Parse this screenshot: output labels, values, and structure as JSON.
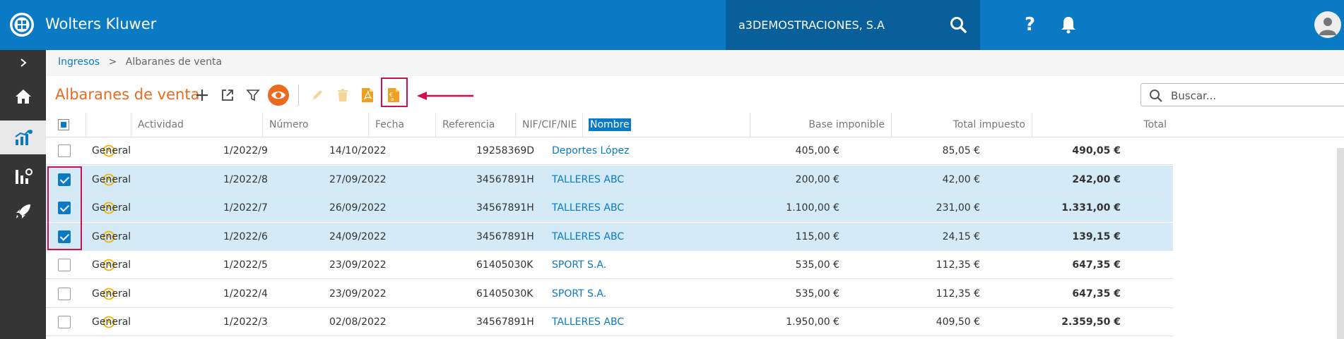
{
  "header": {
    "brand": "Wolters Kluwer",
    "company": "a3DEMOSTRACIONES, S.A"
  },
  "breadcrumb": {
    "parent": "Ingresos",
    "separator": ">",
    "current": "Albaranes de venta"
  },
  "page": {
    "title": "Albaranes de venta"
  },
  "search": {
    "placeholder": "Buscar..."
  },
  "columns": {
    "actividad": "Actividad",
    "numero": "Número",
    "fecha": "Fecha",
    "referencia": "Referencia",
    "nif": "NIF/CIF/NIE",
    "nombre": "Nombre",
    "base": "Base imponible",
    "impuesto": "Total impuesto",
    "total": "Total"
  },
  "rows": [
    {
      "selected": false,
      "actividad": "General",
      "numero": "1/2022/9",
      "fecha": "14/10/2022",
      "referencia": "",
      "nif": "19258369D",
      "nombre": "Deportes López",
      "base": "405,00 €",
      "impuesto": "85,05 €",
      "total": "490,05 €"
    },
    {
      "selected": true,
      "actividad": "General",
      "numero": "1/2022/8",
      "fecha": "27/09/2022",
      "referencia": "",
      "nif": "34567891H",
      "nombre": "TALLERES ABC",
      "base": "200,00 €",
      "impuesto": "42,00 €",
      "total": "242,00 €"
    },
    {
      "selected": true,
      "actividad": "General",
      "numero": "1/2022/7",
      "fecha": "26/09/2022",
      "referencia": "",
      "nif": "34567891H",
      "nombre": "TALLERES ABC",
      "base": "1.100,00 €",
      "impuesto": "231,00 €",
      "total": "1.331,00 €"
    },
    {
      "selected": true,
      "actividad": "General",
      "numero": "1/2022/6",
      "fecha": "24/09/2022",
      "referencia": "",
      "nif": "34567891H",
      "nombre": "TALLERES ABC",
      "base": "115,00 €",
      "impuesto": "24,15 €",
      "total": "139,15 €"
    },
    {
      "selected": false,
      "actividad": "General",
      "numero": "1/2022/5",
      "fecha": "23/09/2022",
      "referencia": "",
      "nif": "61405030K",
      "nombre": "SPORT S.A.",
      "base": "535,00 €",
      "impuesto": "112,35 €",
      "total": "647,35 €"
    },
    {
      "selected": false,
      "actividad": "General",
      "numero": "1/2022/4",
      "fecha": "23/09/2022",
      "referencia": "",
      "nif": "61405030K",
      "nombre": "SPORT S.A.",
      "base": "535,00 €",
      "impuesto": "112,35 €",
      "total": "647,35 €"
    },
    {
      "selected": false,
      "actividad": "General",
      "numero": "1/2022/3",
      "fecha": "02/08/2022",
      "referencia": "",
      "nif": "34567891H",
      "nombre": "TALLERES ABC",
      "base": "1.950,00 €",
      "impuesto": "409,50 €",
      "total": "2.359,50 €"
    }
  ],
  "icons": {
    "toolbar": [
      "plus-icon",
      "open-external-icon",
      "filter-icon",
      "eye-icon",
      "edit-icon",
      "trash-icon",
      "pdf-icon",
      "invoice-icon"
    ],
    "sidebar": [
      "expand-chevron-icon",
      "home-icon",
      "sales-chart-icon",
      "analytics-icon",
      "rocket-icon"
    ]
  },
  "colors": {
    "header": "#0a7ac4",
    "accent_orange": "#e86b20",
    "highlight_red": "#d0104c",
    "selected_row": "#d4eaf7",
    "status_clock": "#f0b400"
  }
}
